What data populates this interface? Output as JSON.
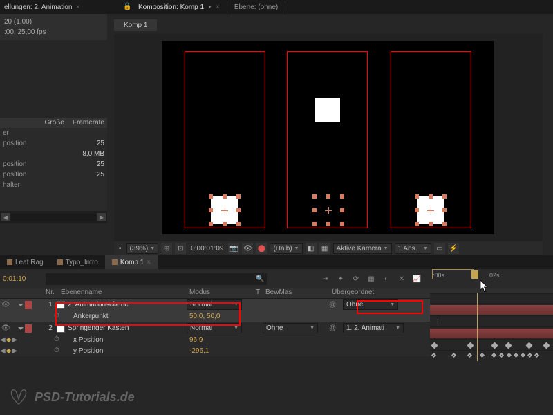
{
  "top": {
    "tab_settings": "ellungen: 2. Animation",
    "komp_tab": "Komposition: Komp 1",
    "ebene_tab": "Ebene: (ohne)"
  },
  "comp_tabstrip": {
    "name": "Komp 1"
  },
  "left": {
    "line1": "20 (1,00)",
    "line2": ":00, 25,00 fps",
    "hdr_size": "Größe",
    "hdr_rate": "Framerate",
    "rows": [
      {
        "label": "er",
        "val": ""
      },
      {
        "label": "position",
        "val": "25"
      },
      {
        "label": "",
        "val": "8,0 MB"
      },
      {
        "label": "position",
        "val": "25"
      },
      {
        "label": "position",
        "val": "25"
      },
      {
        "label": "halter",
        "val": ""
      }
    ]
  },
  "viewer_footer": {
    "zoom": "(39%)",
    "timecode": "0:00:01:09",
    "res": "(Halb)",
    "camera": "Aktive Kamera",
    "views": "1 Ans..."
  },
  "tl_tabs": {
    "t1": "Leaf Rag",
    "t2": "Typo_Intro",
    "t3": "Komp 1"
  },
  "tl": {
    "time": "0:01:10",
    "search_ph": "",
    "ruler": {
      "t0": ":00s",
      "t2": "02s"
    },
    "cols": {
      "num": "Nr.",
      "name": "Ebenenname",
      "mode": "Modus",
      "t": "T",
      "bew": "BewMas",
      "parent": "Übergeordnet"
    },
    "layer1": {
      "num": "1",
      "name": "2. Animationsebene",
      "mode": "Normal",
      "parent": "Ohne"
    },
    "layer1_prop": {
      "name": "Ankerpunkt",
      "val": "50,0, 50,0"
    },
    "layer2": {
      "num": "2",
      "name": "Springender Kasten",
      "mode": "Normal",
      "bew": "Ohne",
      "parent": "1. 2. Animati"
    },
    "layer2_p1": {
      "name": "x Position",
      "val": "96,9"
    },
    "layer2_p2": {
      "name": "y Position",
      "val": "-296,1"
    }
  },
  "watermark": "PSD-Tutorials.de"
}
